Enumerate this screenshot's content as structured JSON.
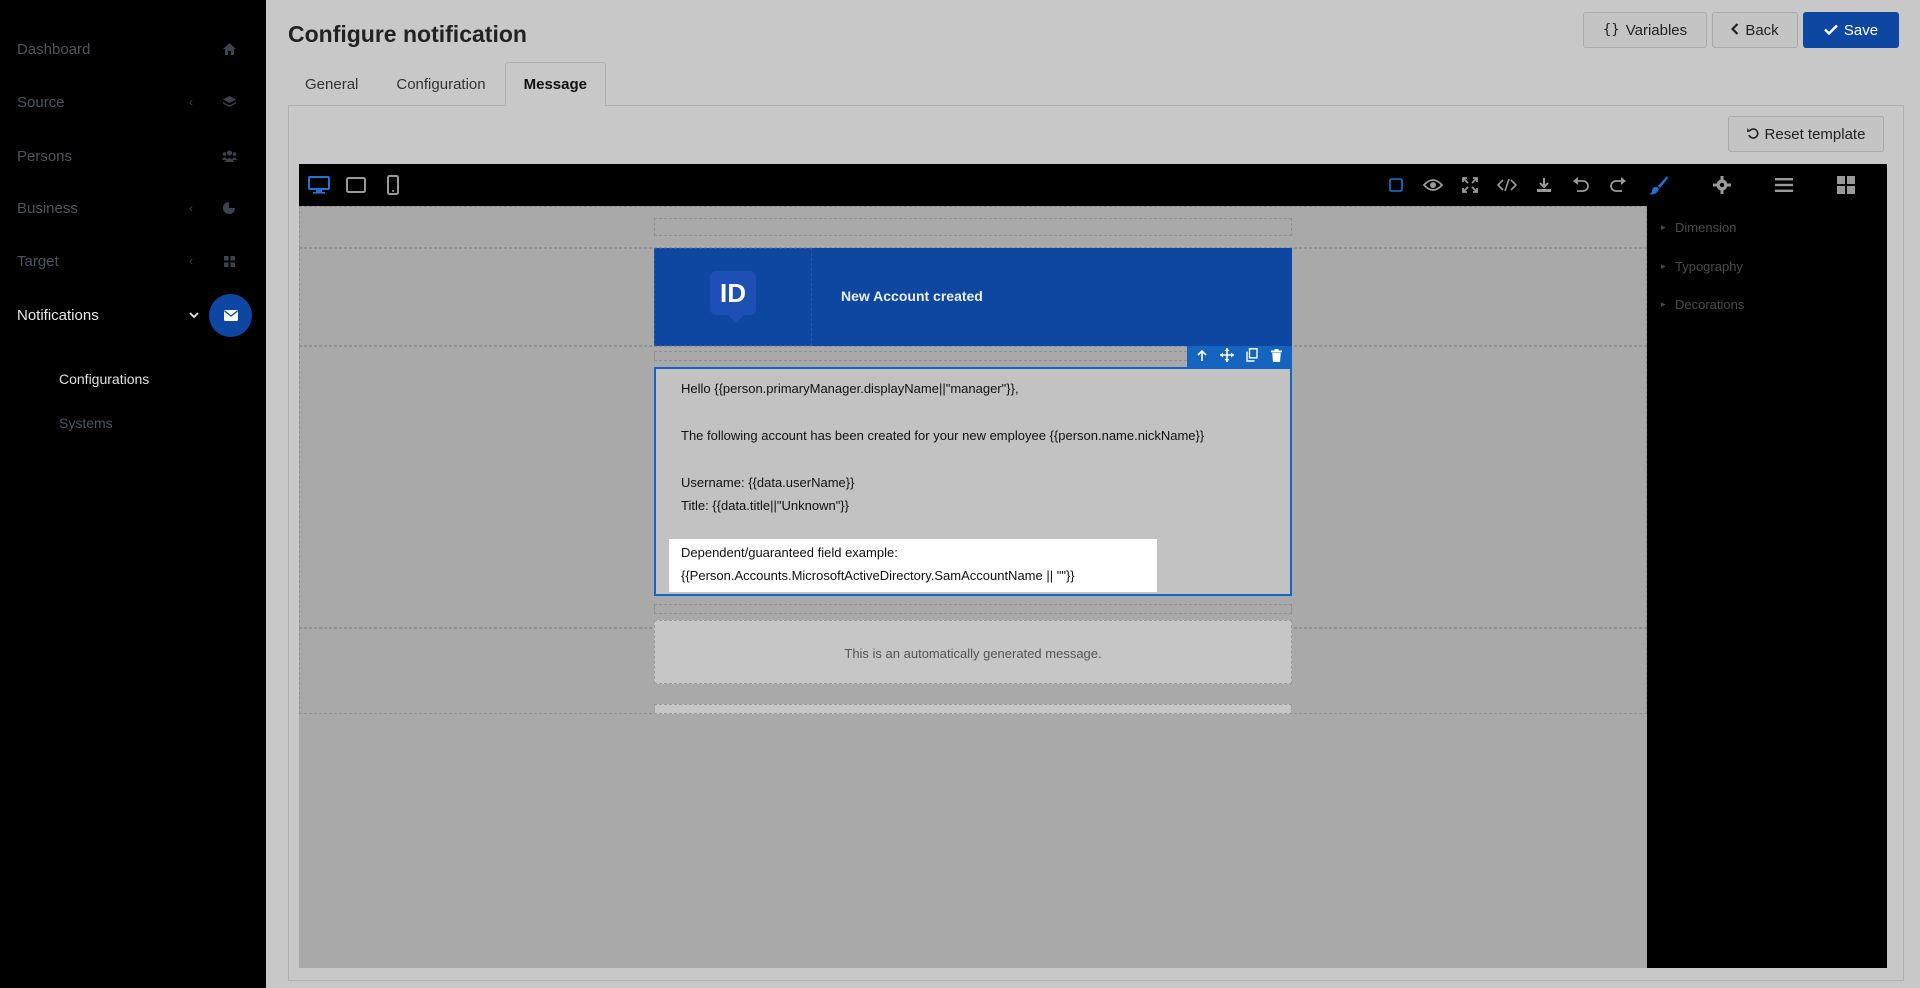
{
  "sidebar": {
    "items": [
      {
        "label": "Dashboard"
      },
      {
        "label": "Source"
      },
      {
        "label": "Persons"
      },
      {
        "label": "Business"
      },
      {
        "label": "Target"
      },
      {
        "label": "Notifications"
      }
    ],
    "sub_items": [
      {
        "label": "Configurations"
      },
      {
        "label": "Systems"
      }
    ]
  },
  "header": {
    "title_prefix": "Configure",
    "title_bold": "notification",
    "variables_label": "Variables",
    "back_label": "Back",
    "save_label": "Save"
  },
  "tabs": [
    {
      "label": "General"
    },
    {
      "label": "Configuration"
    },
    {
      "label": "Message"
    }
  ],
  "reset_label": "Reset template",
  "style_panel": {
    "sections": [
      "Dimension",
      "Typography",
      "Decorations"
    ]
  },
  "email": {
    "logo_text": "ID",
    "header_title": "New Account created",
    "lines": [
      "Hello {{person.primaryManager.displayName||\"manager\"}},",
      "The following account has been created for your new employee {{person.name.nickName}}",
      "Username: {{data.userName}}",
      "Title: {{data.title||\"Unknown\"}}"
    ],
    "dependent_lines": [
      "Dependent/guaranteed field example:",
      "{{Person.Accounts.MicrosoftActiveDirectory.SamAccountName || \"\"}}"
    ],
    "footer_text": "This is an automatically generated message."
  },
  "colors": {
    "accent": "#0d47a1",
    "selection": "#1565c0",
    "sidebar_bg": "#000000",
    "canvas_bg": "#a9a9a9"
  }
}
